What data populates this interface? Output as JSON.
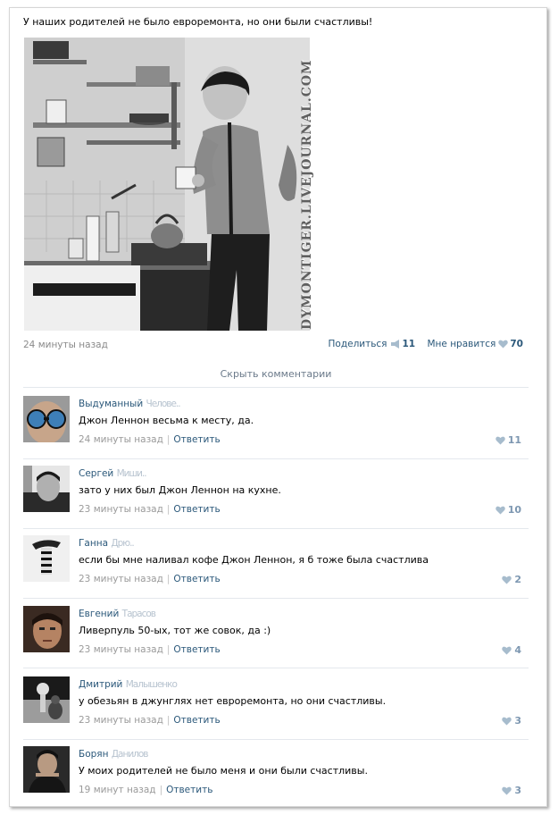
{
  "post": {
    "text": "У наших родителей не было евроремонта, но они были счастливы!",
    "watermark": "DYMONTIGER.LIVEJOURNAL.COM",
    "time": "24 минуты назад",
    "share_label": "Поделиться",
    "share_count": "11",
    "like_label": "Мне нравится",
    "like_count": "70"
  },
  "hide_comments_label": "Скрыть комментарии",
  "comments": [
    {
      "name": "Выдуманный",
      "name_blurred": "Челове..",
      "text": "Джон Леннон весьма к месту, да.",
      "time": "24 минуты назад",
      "separator": "|",
      "reply": "Ответить",
      "likes": "11"
    },
    {
      "name": "Сергей",
      "name_blurred": "Миши..",
      "text": "зато у них был Джон Леннон на кухне.",
      "time": "23 минуты назад",
      "separator": "|",
      "reply": "Ответить",
      "likes": "10"
    },
    {
      "name": "Ганна",
      "name_blurred": "Дрю..",
      "text": "если бы мне наливал кофе Джон Леннон, я б тоже была счастлива",
      "time": "23 минуты назад",
      "separator": "|",
      "reply": "Ответить",
      "likes": "2"
    },
    {
      "name": "Евгений",
      "name_blurred": "Тарасов",
      "text": "Ливерпуль 50-ых, тот же совок, да :)",
      "time": "23 минуты назад",
      "separator": "|",
      "reply": "Ответить",
      "likes": "4"
    },
    {
      "name": "Дмитрий",
      "name_blurred": "Малышенко",
      "text": "у обезьян в джунглях нет евроремонта, но они счастливы.",
      "time": "23 минуты назад",
      "separator": "|",
      "reply": "Ответить",
      "likes": "3"
    },
    {
      "name": "Борян",
      "name_blurred": "Данилов",
      "text": "У моих родителей не было меня и они были счастливы.",
      "time": "19 минут назад",
      "separator": "|",
      "reply": "Ответить",
      "likes": "3"
    }
  ],
  "colors": {
    "link": "#2b587a",
    "muted": "#8a8a8a",
    "heart": "#a7bccd",
    "divider": "#e4e8ed"
  },
  "icons": {
    "share": "megaphone-icon",
    "like": "heart-icon"
  }
}
